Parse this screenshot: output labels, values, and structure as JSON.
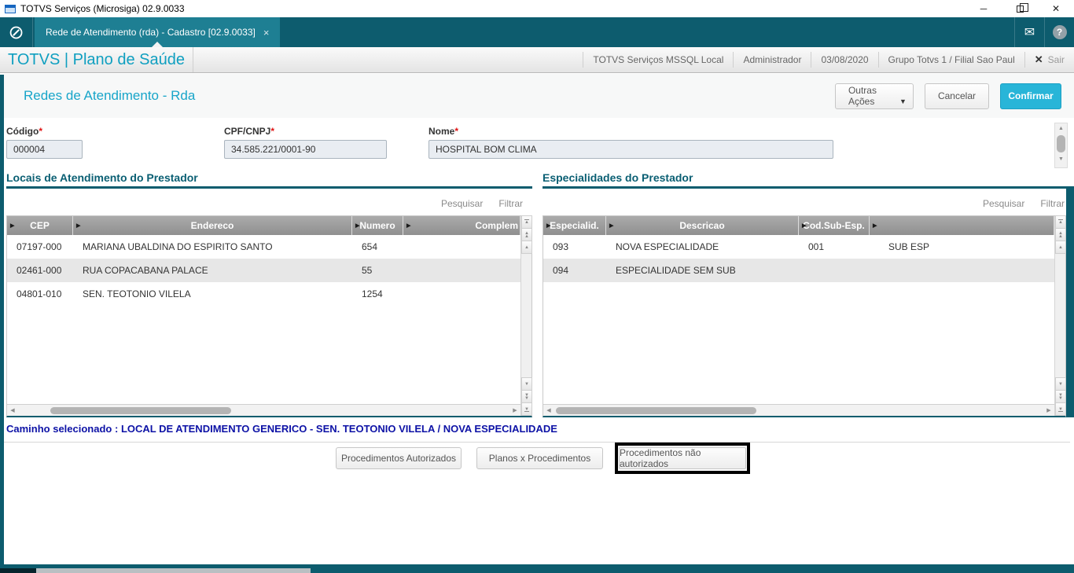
{
  "window": {
    "title": "TOTVS Serviços (Microsiga) 02.9.0033"
  },
  "tab_bar": {
    "active_tab": "Rede de Atendimento (rda) - Cadastro [02.9.0033]"
  },
  "header": {
    "brand": "TOTVS | Plano de Saúde",
    "environment": "TOTVS Serviços MSSQL Local",
    "user": "Administrador",
    "date": "03/08/2020",
    "company": "Grupo Totvs 1 / Filial Sao Paul",
    "exit_label": "Sair"
  },
  "toolbar": {
    "page_title": "Redes de Atendimento - Rda",
    "other_actions_label": "Outras Ações",
    "cancel_label": "Cancelar",
    "confirm_label": "Confirmar"
  },
  "form": {
    "fields": [
      {
        "label": "Código",
        "required": "*",
        "value": "000004"
      },
      {
        "label": "CPF/CNPJ",
        "required": "*",
        "value": "34.585.221/0001-90"
      },
      {
        "label": "Nome",
        "required": "*",
        "value": "HOSPITAL BOM CLIMA"
      }
    ]
  },
  "left_panel": {
    "title": "Locais de Atendimento do Prestador",
    "search_label": "Pesquisar",
    "filter_label": "Filtrar",
    "columns": [
      "CEP",
      "Endereco",
      "Numero",
      "Complem"
    ],
    "rows": [
      {
        "cep": "07197-000",
        "endereco": "MARIANA UBALDINA DO ESPIRITO SANTO",
        "numero": "654",
        "complemento": ""
      },
      {
        "cep": "02461-000",
        "endereco": "RUA COPACABANA PALACE",
        "numero": "55",
        "complemento": ""
      },
      {
        "cep": "04801-010",
        "endereco": "SEN. TEOTONIO VILELA",
        "numero": "1254",
        "complemento": ""
      }
    ]
  },
  "right_panel": {
    "title": "Especialidades do Prestador",
    "search_label": "Pesquisar",
    "filter_label": "Filtrar",
    "columns": [
      "Especialid.",
      "Descricao",
      "Cod.Sub-Esp.",
      ""
    ],
    "rows": [
      {
        "especialidade": "093",
        "descricao": "NOVA ESPECIALIDADE",
        "cod_sub_esp": "001",
        "sub_descricao": "SUB ESP"
      },
      {
        "especialidade": "094",
        "descricao": "ESPECIALIDADE  SEM SUB",
        "cod_sub_esp": "",
        "sub_descricao": ""
      }
    ]
  },
  "footer": {
    "caminho_label": "Caminho selecionado :",
    "caminho_value": "LOCAL DE ATENDIMENTO GENERICO - SEN. TEOTONIO VILELA / NOVA ESPECIALIDADE",
    "buttons": [
      "Procedimentos Autorizados",
      "Planos x Procedimentos",
      "Procedimentos não autorizados"
    ]
  },
  "icons": {
    "logo": "⊘",
    "mail": "✉",
    "help": "?",
    "tab_close": "×",
    "minimize": "─",
    "close": "✕",
    "exit_x": "✕",
    "dropdown": "▼",
    "up": "▲",
    "down": "▼",
    "left": "◀",
    "right": "▶",
    "col_arrow": "▶"
  },
  "colors": {
    "teal_dark": "#0d5c6e",
    "tab_active": "#1e7f93",
    "brand_text": "#0f9fc0",
    "confirm_button": "#28b5d8",
    "section_title": "#0a5f73",
    "caminho_text": "#0d12a6",
    "grid_header": "#9b9b9b",
    "alt_row": "#e7e7e7",
    "field_bg": "#e9edf2",
    "required_asterisk": "#e01313",
    "highlight_border": "#000000"
  }
}
